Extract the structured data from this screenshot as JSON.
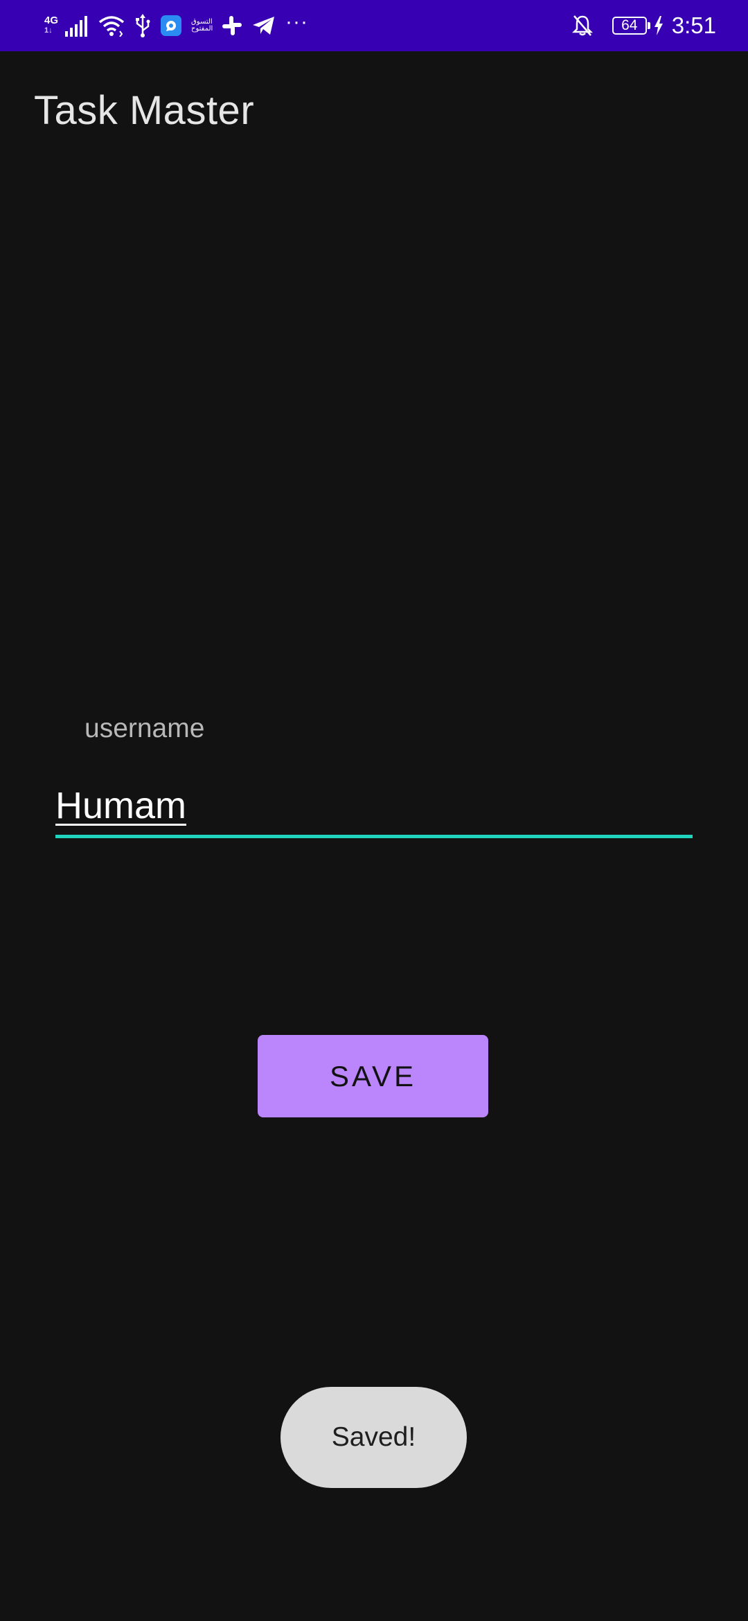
{
  "status_bar": {
    "network_type": "4G",
    "network_sub": "1↓",
    "clock": "3:51",
    "battery_level": "64",
    "arabic_app_label_line1": "التسوق",
    "arabic_app_label_line2": "المفتوح",
    "overflow": "···",
    "background_color": "#3700B3",
    "icons": [
      "signal-icon",
      "wifi-icon",
      "usb-icon",
      "chat-app-icon",
      "arabic-shopping-app-icon",
      "slack-icon",
      "telegram-icon",
      "more-notifications-icon",
      "notifications-off-icon",
      "battery-icon",
      "charging-icon"
    ]
  },
  "header": {
    "title": "Task Master"
  },
  "form": {
    "username_label": "username",
    "username_value": "Humam",
    "accent_color": "#1fd3bd",
    "save_label": "SAVE",
    "save_color": "#BB86FC"
  },
  "toast": {
    "message": "Saved!"
  },
  "background_color": "#121212"
}
